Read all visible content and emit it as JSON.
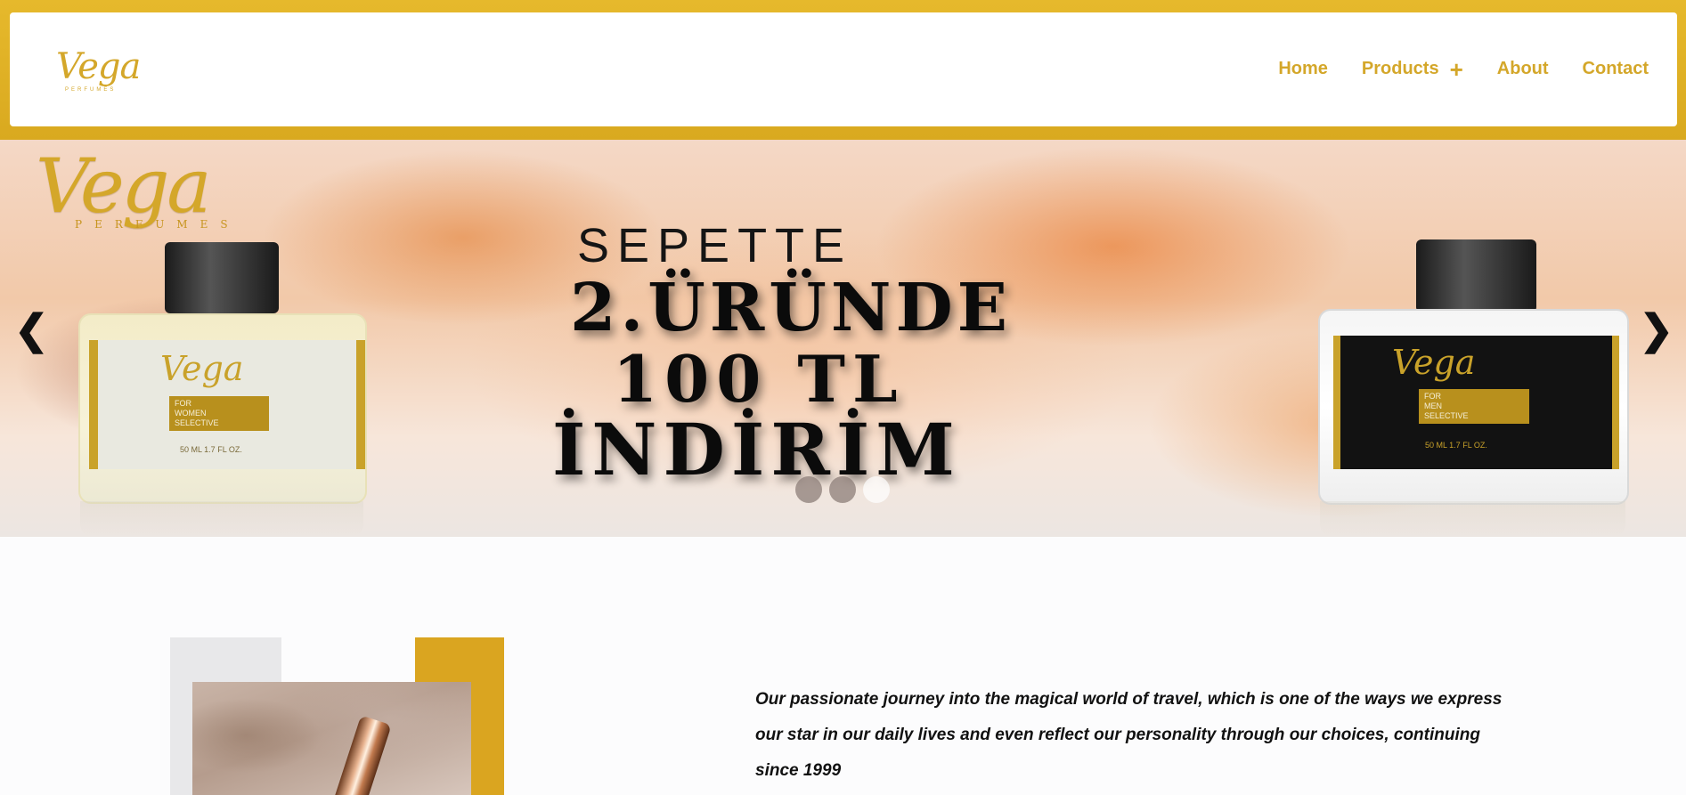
{
  "header": {
    "logo_text": "Vega",
    "logo_sub": "PERFUMES",
    "nav": {
      "home": "Home",
      "products": "Products",
      "products_icon": "plus-icon",
      "about": "About",
      "contact": "Contact"
    }
  },
  "hero": {
    "logo_text": "Vega",
    "logo_sub": "PERFUMES",
    "line1": "SEPETTE",
    "line2": "2.ÜRÜNDE",
    "line3": "100 TL",
    "line4": "İNDİRİM",
    "left_bottle": {
      "brand": "Vega",
      "tag_line1": "FOR",
      "tag_line2": "WOMEN",
      "tag_line3": "SELECTIVE",
      "size": "50 ML   1.7 FL OZ."
    },
    "right_bottle": {
      "brand": "Vega",
      "tag_line1": "FOR",
      "tag_line2": "MEN",
      "tag_line3": "SELECTIVE",
      "size": "50 ML   1.7 FL OZ."
    },
    "prev_arrow": "❮",
    "next_arrow": "❯",
    "slide_count": 3,
    "active_slide": 3
  },
  "about": {
    "text": "Our passionate journey into the magical world of travel, which is one of the ways we express our star in our daily lives and even reflect our personality through our choices, continuing since 1999"
  },
  "colors": {
    "brand_gold": "#d4a72a",
    "accent_gold": "#daa520"
  }
}
